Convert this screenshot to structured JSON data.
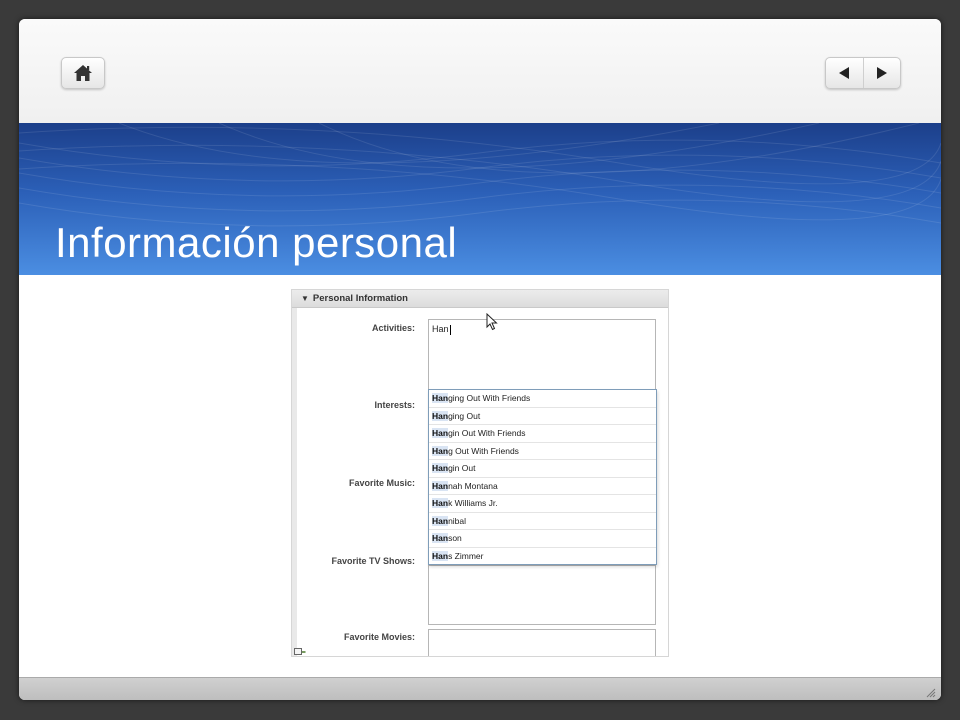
{
  "slide": {
    "title": "Información personal"
  },
  "nav": {
    "home_icon": "home-icon",
    "prev_icon": "triangle-left-icon",
    "next_icon": "triangle-right-icon"
  },
  "form": {
    "section_title": "Personal Information",
    "labels": {
      "activities": "Activities:",
      "interests": "Interests:",
      "music": "Favorite Music:",
      "tv": "Favorite TV Shows:",
      "movies": "Favorite Movies:"
    },
    "activities_value": "Han",
    "suggestions": [
      {
        "match": "Han",
        "rest": "ging Out With Friends"
      },
      {
        "match": "Han",
        "rest": "ging Out"
      },
      {
        "match": "Han",
        "rest": "gin Out With Friends"
      },
      {
        "match": "Han",
        "rest": "g Out With Friends"
      },
      {
        "match": "Han",
        "rest": "gin Out"
      },
      {
        "match": "Han",
        "rest": "nah Montana"
      },
      {
        "match": "Han",
        "rest": "k Williams Jr."
      },
      {
        "match": "Han",
        "rest": "nibal"
      },
      {
        "match": "Han",
        "rest": "son"
      },
      {
        "match": "Han",
        "rest": "s Zimmer"
      }
    ]
  },
  "colors": {
    "banner_top": "#1c3f8a",
    "banner_bottom": "#4b8ee2",
    "highlight": "#d9e4f3"
  }
}
